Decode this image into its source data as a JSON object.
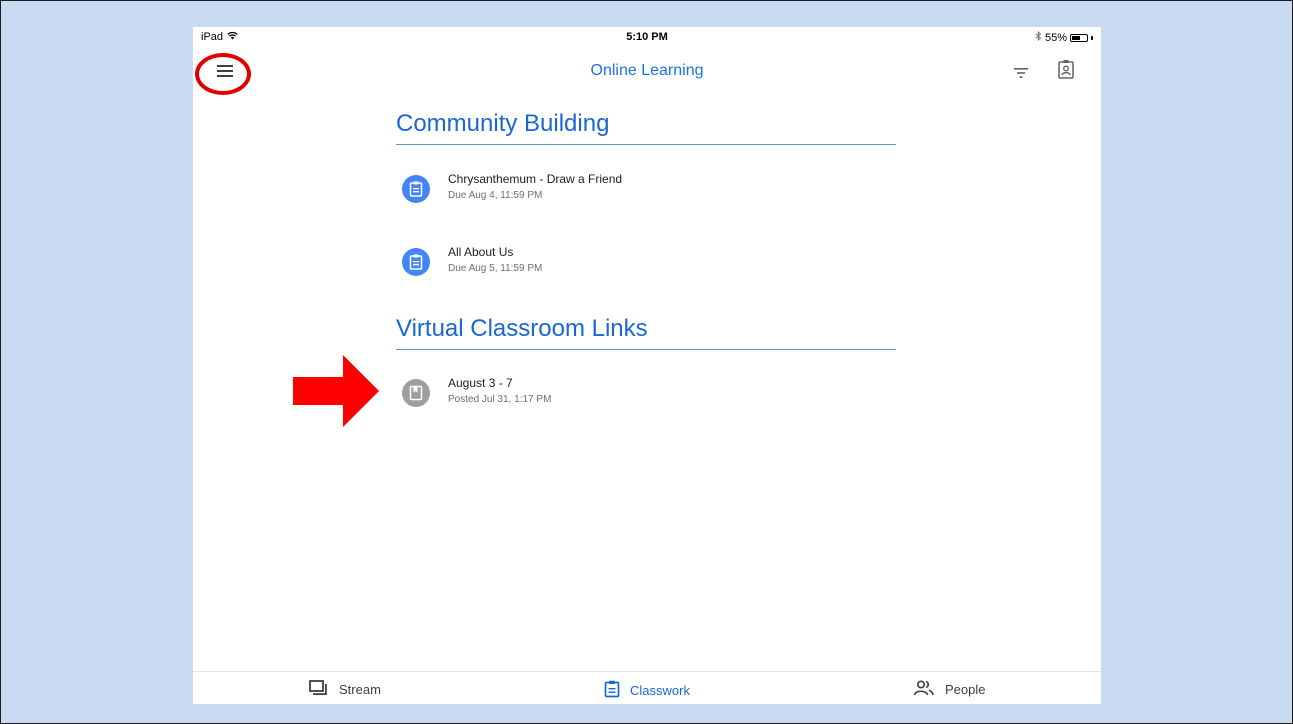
{
  "status_bar": {
    "device": "iPad",
    "time": "5:10 PM",
    "battery": "55%",
    "battery_level": 0.55
  },
  "header": {
    "title": "Online Learning",
    "icons": [
      "menu-icon",
      "filter-icon",
      "class-profile-icon"
    ]
  },
  "topics": [
    {
      "title": "Community Building",
      "items": [
        {
          "title": "Chrysanthemum - Draw a Friend",
          "subtitle": "Due Aug 4, 11:59 PM",
          "icon": "assignment-icon",
          "icon_color": "#4285f4"
        },
        {
          "title": "All About Us",
          "subtitle": "Due Aug 5, 11:59 PM",
          "icon": "assignment-icon",
          "icon_color": "#4285f4"
        }
      ]
    },
    {
      "title": "Virtual Classroom Links",
      "items": [
        {
          "title": "August 3 - 7",
          "subtitle": "Posted Jul 31, 1:17 PM",
          "icon": "material-icon",
          "icon_color": "#9e9e9e"
        }
      ]
    }
  ],
  "bottom_nav": {
    "tabs": [
      {
        "label": "Stream",
        "icon": "stream-icon",
        "active": false
      },
      {
        "label": "Classwork",
        "icon": "classwork-icon",
        "active": true
      },
      {
        "label": "People",
        "icon": "people-icon",
        "active": false
      }
    ]
  },
  "colors": {
    "accent": "#1967d2",
    "slide_background": "#c9daf3",
    "annotation": "#e00000"
  }
}
